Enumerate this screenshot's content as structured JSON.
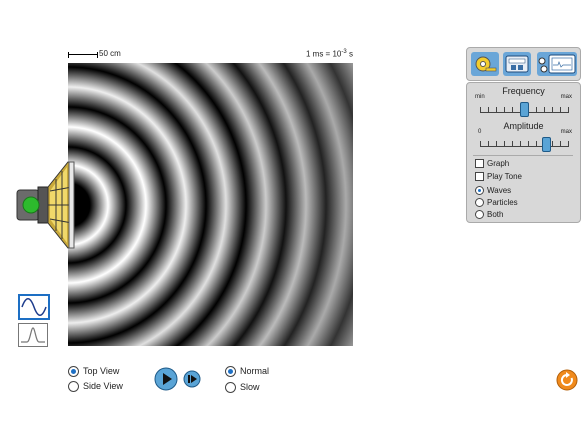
{
  "scale": {
    "length_label": "50 cm",
    "time_label": "1 ms = 10",
    "time_exp": "-3",
    "time_unit": "s"
  },
  "frequency": {
    "title": "Frequency",
    "min_label": "min",
    "max_label": "max",
    "value": 0.5
  },
  "amplitude": {
    "title": "Amplitude",
    "min_label": "0",
    "max_label": "max",
    "value": 0.75
  },
  "checkboxes": [
    {
      "label": "Graph",
      "checked": false
    },
    {
      "label": "Play Tone",
      "checked": false
    }
  ],
  "display_modes": [
    {
      "label": "Waves",
      "selected": true
    },
    {
      "label": "Particles",
      "selected": false
    },
    {
      "label": "Both",
      "selected": false
    }
  ],
  "views": [
    {
      "label": "Top View",
      "selected": true
    },
    {
      "label": "Side View",
      "selected": false
    }
  ],
  "speeds": [
    {
      "label": "Normal",
      "selected": true
    },
    {
      "label": "Slow",
      "selected": false
    }
  ],
  "tools": [
    "tape-measure-icon",
    "stopwatch-icon",
    "wave-meter-icon"
  ],
  "icons": [
    "speaker-icon",
    "sine-wave-icon",
    "pulse-wave-icon",
    "play-icon",
    "step-icon",
    "reset-icon"
  ],
  "colors": {
    "accent": "#1d6fc4",
    "speaker_light": "#2dbb2d",
    "reset": "#f08a1c"
  }
}
